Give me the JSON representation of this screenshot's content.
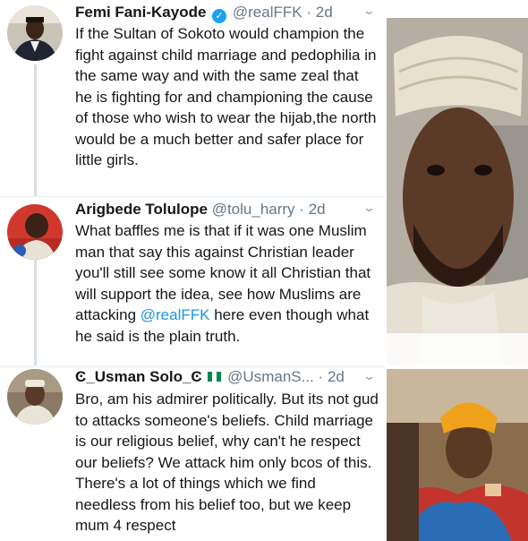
{
  "tweets": [
    {
      "name": "Femi Fani-Kayode",
      "verified": true,
      "handle": "@realFFK",
      "sep": "·",
      "time": "2d",
      "text": "If the Sultan of Sokoto would champion the fight against child marriage and pedophilia in the same way and with the same zeal that he is fighting for and championing the cause of those who wish to wear the hijab,the north would be a much better and safer place for little girls."
    },
    {
      "name": "Arigbede Tolulope",
      "handle": "@tolu_harry",
      "sep": "·",
      "time": "2d",
      "text_before": "What baffles me is that if it was one Muslim man that say this against Christian leader you'll still see some know it all Christian that will support the idea, see how Muslims are attacking ",
      "mention": "@realFFK",
      "text_after": " here even though what he said is the plain truth."
    },
    {
      "name_prefix": "Ͼ_Usman Solo_Ͼ",
      "handle": "@UsmanS...",
      "sep": "·",
      "time": "2d",
      "text": "Bro,  am his admirer politically. But its not gud to attacks someone's beliefs. Child marriage is our religious belief, why can't he respect our beliefs? We attack him only bcos of this. There's a lot of things which we find needless from his belief too, but we keep mum 4 respect"
    }
  ],
  "icons": {
    "verified": "verified-check-icon",
    "menu": "chevron-down-icon"
  },
  "colors": {
    "link": "#1b95e0",
    "handle": "#657786",
    "verified": "#1da1f2"
  }
}
